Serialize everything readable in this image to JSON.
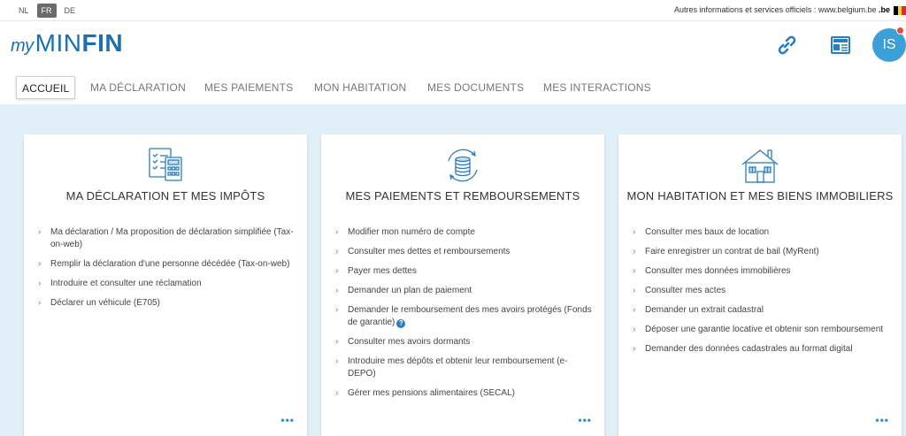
{
  "topbar": {
    "languages": [
      {
        "code": "NL",
        "active": false
      },
      {
        "code": "FR",
        "active": true
      },
      {
        "code": "DE",
        "active": false
      }
    ],
    "other_info": "Autres informations et services officiels : www.belgium.be",
    "be_logo": ".be"
  },
  "header": {
    "logo_my": "my",
    "logo_min": "MIN",
    "logo_fin": "FIN",
    "icons": [
      "link-icon",
      "news-icon"
    ],
    "avatar_initials": "IS",
    "brand_color": "#1b6fb3",
    "avatar_color": "#3d9fd8",
    "notification_color": "#e74c3c"
  },
  "nav": {
    "items": [
      {
        "label": "ACCUEIL",
        "active": true
      },
      {
        "label": "MA DÉCLARATION",
        "active": false
      },
      {
        "label": "MES PAIEMENTS",
        "active": false
      },
      {
        "label": "MON HABITATION",
        "active": false
      },
      {
        "label": "MES DOCUMENTS",
        "active": false
      },
      {
        "label": "MES INTERACTIONS",
        "active": false
      }
    ]
  },
  "cards": [
    {
      "icon": "tax-form-calculator-icon",
      "title": "MA DÉCLARATION ET MES IMPÔTS",
      "links": [
        "Ma déclaration / Ma proposition de déclaration simplifiée (Tax-on-web)",
        "Remplir la déclaration d'une personne décédée (Tax-on-web)",
        "Introduire et consulter une réclamation",
        "Déclarer un véhicule (E705)"
      ],
      "more": "•••"
    },
    {
      "icon": "coins-refresh-icon",
      "title": "MES PAIEMENTS ET REMBOURSEMENTS",
      "links": [
        "Modifier mon numéro de compte",
        "Consulter mes dettes et remboursements",
        "Payer mes dettes",
        "Demander un plan de paiement",
        "Demander le remboursement des mes avoirs protégés (Fonds de garantie)",
        "Consulter mes avoirs dormants",
        "Introduire mes dépôts et obtenir leur remboursement (e-DEPO)",
        "Gérer mes pensions alimentaires (SECAL)"
      ],
      "help_mark": "?",
      "more": "•••"
    },
    {
      "icon": "house-icon",
      "title": "MON HABITATION ET MES BIENS IMMOBILIERS",
      "links": [
        "Consulter mes baux de location",
        "Faire enregistrer un contrat de bail (MyRent)",
        "Consulter mes données immobilières",
        "Consulter mes actes",
        "Demander un extrait cadastral",
        "Déposer une garantie locative et obtenir son remboursement",
        "Demander des données cadastrales au format digital"
      ],
      "more": "•••"
    }
  ]
}
